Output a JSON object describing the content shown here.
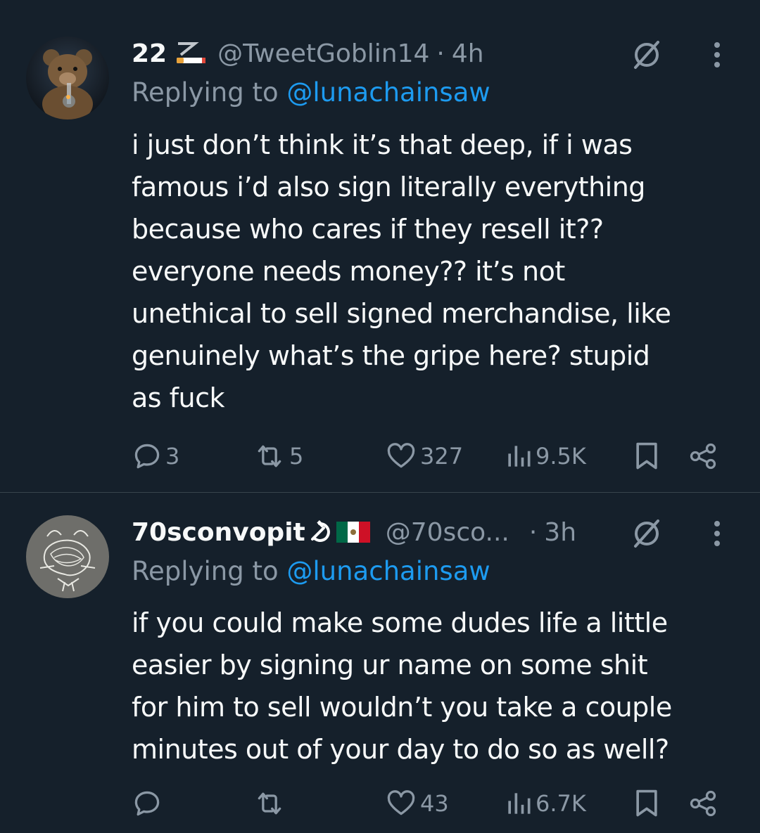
{
  "tweets": [
    {
      "display_name": "22",
      "name_emoji": "cigarette-emoji",
      "handle": "@TweetGoblin14",
      "separator": "·",
      "time": "4h",
      "replying_prefix": "Replying to",
      "replying_to": "@lunachainsaw",
      "text": "i just don’t think it’s that deep, if i was\nfamous i’d also sign literally everything\nbecause who cares if they resell it??\neveryone needs money?? it’s not\nunethical to sell signed merchandise, like\ngenuinely what’s the gripe here? stupid\nas fuck",
      "replies": "3",
      "reposts": "5",
      "likes": "327",
      "views": "9.5K"
    },
    {
      "display_name": "70sconvopit",
      "name_emoji": "hammer-sickle-and-mexico-flag-emoji",
      "handle": "@70sco...",
      "separator": "·",
      "time": "3h",
      "replying_prefix": "Replying to",
      "replying_to": "@lunachainsaw",
      "text": "if you could make some dudes life a little\neasier by signing ur name on some shit\nfor him to sell wouldn’t you take a couple\nminutes out of your day to do so as well?",
      "replies": "",
      "reposts": "",
      "likes": "43",
      "views": "6.7K"
    }
  ],
  "colors": {
    "background": "#15202b",
    "text": "#f7f9f9",
    "secondary": "#8b98a5",
    "link": "#1d9bf0",
    "divider": "#38444d"
  }
}
